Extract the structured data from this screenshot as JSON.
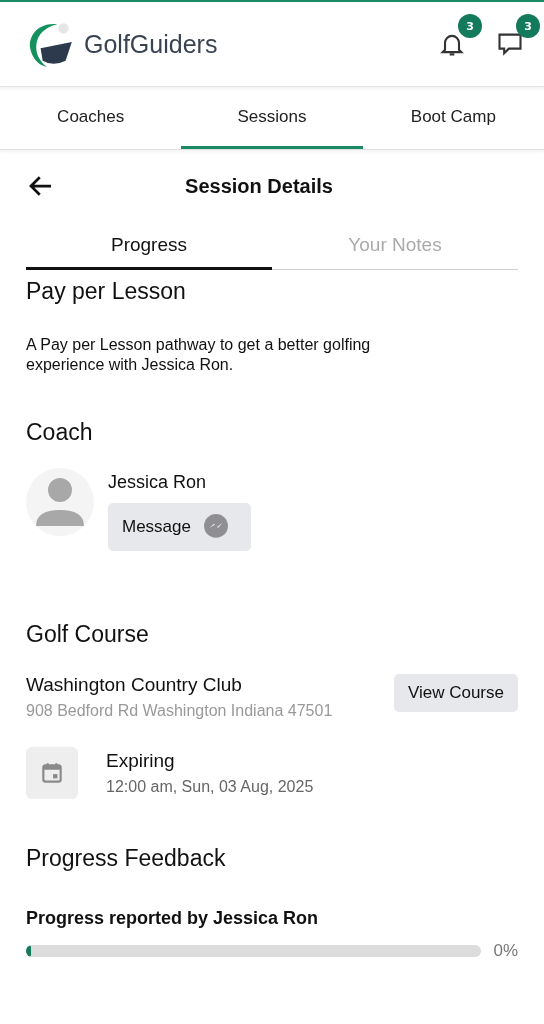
{
  "app": {
    "brand": "GolfGuiders",
    "notifications_badge": "3",
    "messages_badge": "3"
  },
  "tabs": [
    {
      "label": "Coaches",
      "selected": false
    },
    {
      "label": "Sessions",
      "selected": true
    },
    {
      "label": "Boot Camp",
      "selected": false
    }
  ],
  "page": {
    "title": "Session Details"
  },
  "subtabs": [
    {
      "label": "Progress",
      "selected": true
    },
    {
      "label": "Your Notes",
      "selected": false
    }
  ],
  "lesson": {
    "title": "Pay per Lesson",
    "description": "A Pay per Lesson pathway to get a better golfing experience with Jessica Ron."
  },
  "coach": {
    "heading": "Coach",
    "name": "Jessica Ron",
    "message_button": "Message"
  },
  "course": {
    "heading": "Golf Course",
    "name": "Washington Country Club",
    "address": "908 Bedford Rd Washington Indiana 47501",
    "view_button": "View Course"
  },
  "expiry": {
    "label": "Expiring",
    "date": "12:00 am, Sun, 03 Aug, 2025"
  },
  "feedback": {
    "heading": "Progress Feedback",
    "reporter": "Progress reported by Jessica Ron",
    "level": 0,
    "reading": "0%"
  }
}
